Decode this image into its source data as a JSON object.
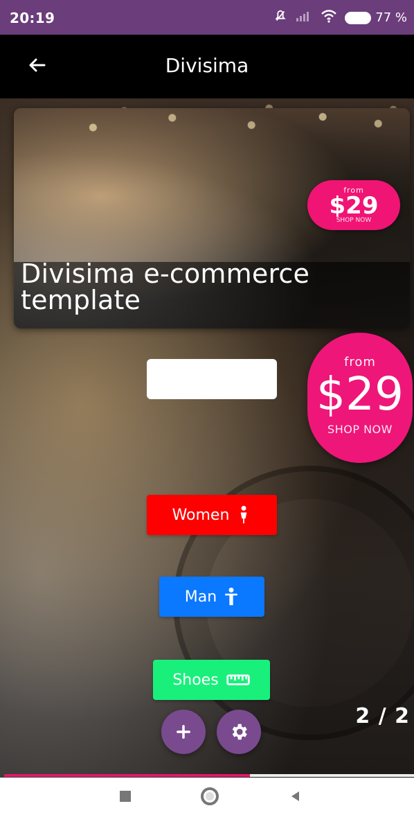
{
  "status_bar": {
    "time": "20:19",
    "battery": "77 %"
  },
  "app_bar": {
    "title": "Divisima"
  },
  "banner": {
    "badge": {
      "from": "from",
      "price": "$29",
      "shop": "SHOP NOW"
    },
    "title": "Divisima e-commerce template"
  },
  "promo_badge": {
    "from": "from",
    "price": "$29",
    "shop": "SHOP NOW"
  },
  "categories": {
    "women": {
      "label": "Women"
    },
    "man": {
      "label": "Man"
    },
    "shoes": {
      "label": "Shoes"
    }
  },
  "carousel": {
    "counter": "2 / 2",
    "progress": 0.6
  },
  "colors": {
    "status_bar": "#6b3d7b",
    "app_bar": "#000000",
    "women": "#ff0000",
    "man": "#0a78ff",
    "shoes": "#19f07c",
    "fab": "#7a4a8f",
    "badge": "#ee1679",
    "progress": "#e3196a"
  }
}
